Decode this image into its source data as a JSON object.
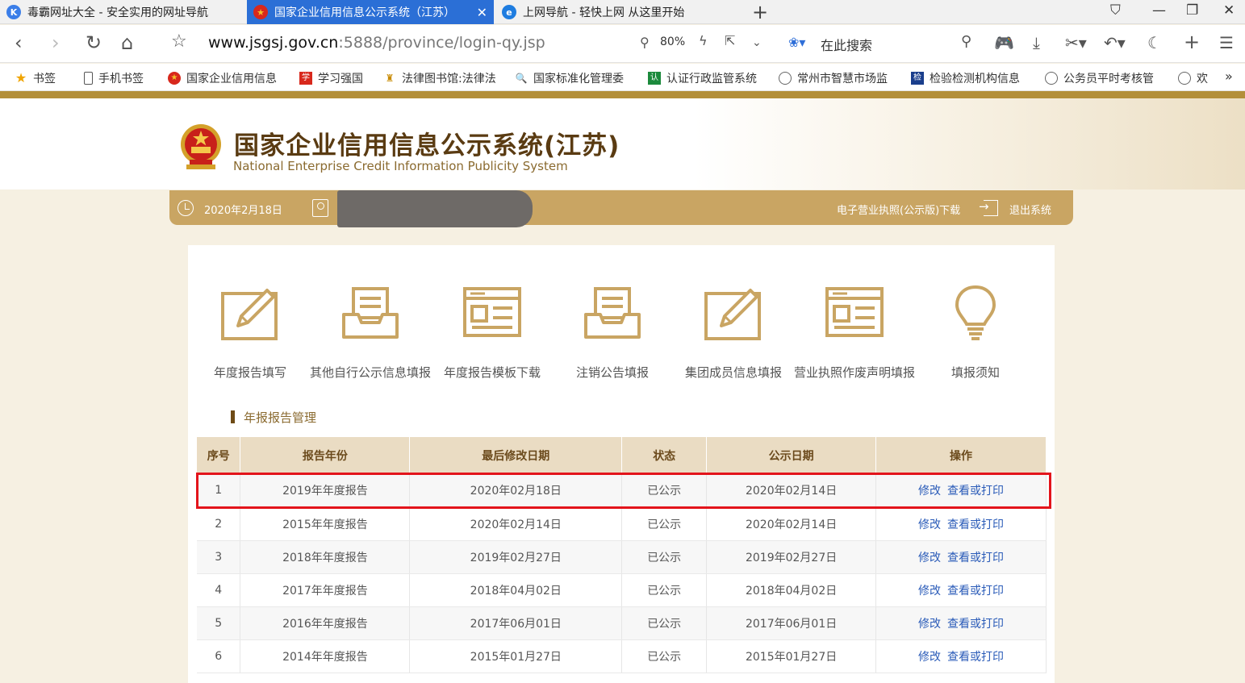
{
  "browser": {
    "tabs": [
      {
        "label": "毒霸网址大全 - 安全实用的网址导航",
        "icon": "k-logo-icon",
        "color": "#3b7ee8"
      },
      {
        "label": "国家企业信用信息公示系统（江苏）",
        "icon": "emblem-icon",
        "active": true
      },
      {
        "label": "上网导航 - 轻快上网 从这里开始",
        "icon": "e-logo-icon",
        "color": "#1f7de0"
      }
    ],
    "url_host": "www.jsgsj.gov.cn",
    "url_rest": ":5888/province/login-qy.jsp",
    "zoom": "80%",
    "search_placeholder": "在此搜索",
    "bookmarks": [
      {
        "label": "书签",
        "icon": "star-icon"
      },
      {
        "label": "手机书签",
        "icon": "phone-icon"
      },
      {
        "label": "国家企业信用信息",
        "icon": "emblem-icon"
      },
      {
        "label": "学习强国",
        "icon": "xuexi-icon"
      },
      {
        "label": "法律图书馆:法律法",
        "icon": "book-icon"
      },
      {
        "label": "国家标准化管理委",
        "icon": "search-doc-icon"
      },
      {
        "label": "认证行政监管系统",
        "icon": "cert-icon"
      },
      {
        "label": "常州市智慧市场监",
        "icon": "globe-icon"
      },
      {
        "label": "检验检测机构信息",
        "icon": "lab-icon"
      },
      {
        "label": "公务员平时考核管",
        "icon": "globe-icon"
      },
      {
        "label": "欢",
        "icon": "globe-icon"
      }
    ]
  },
  "site": {
    "title": "国家企业信用信息公示系统(江苏)",
    "subtitle": "National Enterprise Credit Information Publicity System",
    "date": "2020年2月18日",
    "license_link": "电子营业执照(公示版)下载",
    "exit_link": "退出系统"
  },
  "functions": [
    {
      "label": "年度报告填写",
      "icon": "edit-icon"
    },
    {
      "label": "其他自行公示信息填报",
      "icon": "inbox-icon"
    },
    {
      "label": "年度报告模板下载",
      "icon": "template-icon"
    },
    {
      "label": "注销公告填报",
      "icon": "inbox-icon"
    },
    {
      "label": "集团成员信息填报",
      "icon": "edit-icon"
    },
    {
      "label": "营业执照作废声明填报",
      "icon": "template-icon"
    },
    {
      "label": "填报须知",
      "icon": "lightbulb-icon"
    }
  ],
  "section_title": "年报报告管理",
  "table": {
    "headers": [
      "序号",
      "报告年份",
      "最后修改日期",
      "状态",
      "公示日期",
      "操作"
    ],
    "action_edit": "修改",
    "action_view": "查看或打印",
    "rows": [
      {
        "no": "1",
        "year": "2019年年度报告",
        "modified": "2020年02月18日",
        "status": "已公示",
        "published": "2020年02月14日"
      },
      {
        "no": "2",
        "year": "2015年年度报告",
        "modified": "2020年02月14日",
        "status": "已公示",
        "published": "2020年02月14日"
      },
      {
        "no": "3",
        "year": "2018年年度报告",
        "modified": "2019年02月27日",
        "status": "已公示",
        "published": "2019年02月27日"
      },
      {
        "no": "4",
        "year": "2017年年度报告",
        "modified": "2018年04月02日",
        "status": "已公示",
        "published": "2018年04月02日"
      },
      {
        "no": "5",
        "year": "2016年年度报告",
        "modified": "2017年06月01日",
        "status": "已公示",
        "published": "2017年06月01日"
      },
      {
        "no": "6",
        "year": "2014年年度报告",
        "modified": "2015年01月27日",
        "status": "已公示",
        "published": "2015年01月27日"
      }
    ]
  },
  "colors": {
    "accent": "#c9a563",
    "brown": "#5a3b12",
    "link": "#2a5bb8",
    "highlight": "#e3141b"
  }
}
